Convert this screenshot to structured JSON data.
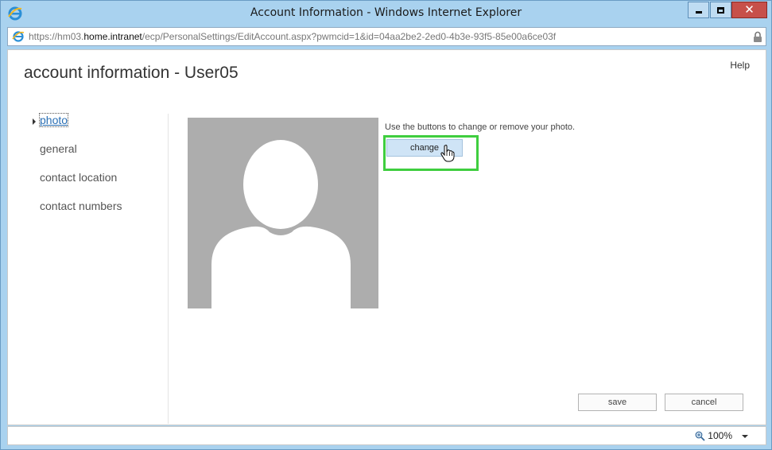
{
  "window": {
    "title": "Account Information - Windows Internet Explorer",
    "close_glyph": "✕"
  },
  "address": {
    "prefix": "https://hm03.",
    "host": "home.intranet",
    "path": "/ecp/PersonalSettings/EditAccount.aspx?pwmcid=1&id=04aa2be2-2ed0-4b3e-93f5-85e00a6ce03f"
  },
  "page": {
    "title": "account information - User05",
    "help_label": "Help"
  },
  "nav": {
    "items": [
      {
        "label": "photo",
        "selected": true
      },
      {
        "label": "general"
      },
      {
        "label": "contact location"
      },
      {
        "label": "contact numbers"
      }
    ]
  },
  "photo": {
    "hint": "Use the buttons to change or remove your photo.",
    "change_label": "change"
  },
  "actions": {
    "save_label": "save",
    "cancel_label": "cancel"
  },
  "status": {
    "zoom": "100%"
  },
  "colors": {
    "chrome": "#a9d2ef",
    "highlight": "#3fce3f",
    "link": "#2a6fb4",
    "close_button": "#c7504a"
  },
  "icons": {
    "browser": "ie-logo-icon",
    "lock": "lock-icon",
    "cursor": "hand-cursor-icon",
    "zoom": "zoom-icon"
  }
}
